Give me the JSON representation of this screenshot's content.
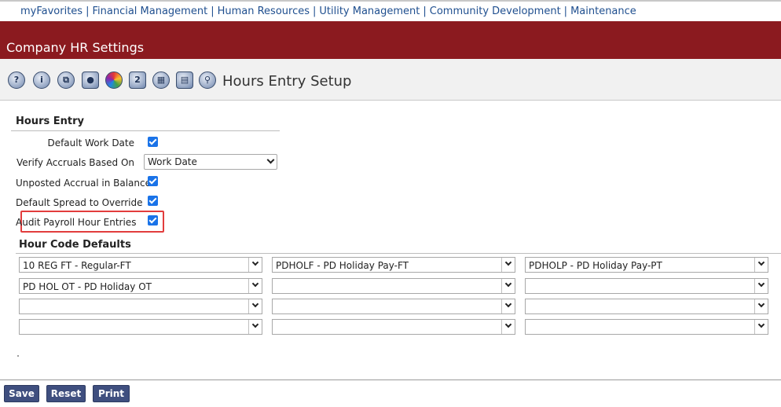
{
  "nav": {
    "items": [
      "myFavorites",
      "Financial Management",
      "Human Resources",
      "Utility Management",
      "Community Development",
      "Maintenance"
    ],
    "separator": "|"
  },
  "banner": {
    "title": "Company HR Settings"
  },
  "toolbar": {
    "icons": [
      "help-icon",
      "info-icon",
      "copy-icon",
      "lock-icon",
      "color-wheel-icon",
      "two-icon",
      "grid-icon",
      "document-icon",
      "search-user-icon"
    ],
    "icon_glyph_two": "2",
    "page_title": "Hours Entry Setup"
  },
  "hours_entry": {
    "title": "Hours Entry",
    "fields": {
      "default_work_date": {
        "label": "Default Work Date",
        "checked": true
      },
      "verify_accruals": {
        "label": "Verify Accruals Based On",
        "value": "Work Date"
      },
      "unposted_accrual": {
        "label": "Unposted Accrual in Balance",
        "checked": true
      },
      "default_spread": {
        "label": "Default Spread to Override",
        "checked": true
      },
      "audit_payroll": {
        "label": "Audit Payroll Hour Entries",
        "checked": true
      }
    }
  },
  "hour_code_defaults": {
    "title": "Hour Code Defaults",
    "rows": [
      [
        "10 REG FT - Regular-FT",
        "PDHOLF - PD Holiday Pay-FT",
        "PDHOLP - PD Holiday Pay-PT"
      ],
      [
        "PD HOL OT - PD Holiday OT",
        "",
        ""
      ],
      [
        "",
        "",
        ""
      ],
      [
        "",
        "",
        ""
      ]
    ]
  },
  "actions": {
    "save": "Save",
    "reset": "Reset",
    "print": "Print"
  },
  "colors": {
    "banner": "#8b1a1f",
    "link": "#1f4f8f",
    "checkbox": "#1a73e8",
    "highlight": "#e23d3d",
    "button": "#3f4f7f"
  }
}
